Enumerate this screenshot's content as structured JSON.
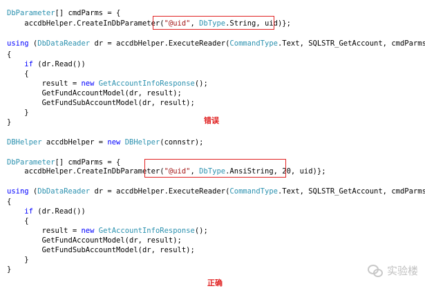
{
  "block1": {
    "lines": [
      [
        {
          "t": "DbParameter",
          "c": "ty"
        },
        {
          "t": "[] cmdParms = {"
        }
      ],
      [
        {
          "t": "    accdbHelper.CreateInDbParameter("
        },
        {
          "t": "\"@uid\"",
          "c": "str"
        },
        {
          "t": ", "
        },
        {
          "t": "DbType",
          "c": "ty"
        },
        {
          "t": ".String, uid)"
        },
        {
          "t": "};"
        }
      ],
      [
        {
          "t": ""
        }
      ],
      [
        {
          "t": "using",
          "c": "kw"
        },
        {
          "t": " ("
        },
        {
          "t": "DbDataReader",
          "c": "ty"
        },
        {
          "t": " dr = accdbHelper.ExecuteReader("
        },
        {
          "t": "CommandType",
          "c": "ty"
        },
        {
          "t": ".Text, SQLSTR_GetAccount, cmdParms))"
        }
      ],
      [
        {
          "t": "{"
        }
      ],
      [
        {
          "t": "    "
        },
        {
          "t": "if",
          "c": "kw"
        },
        {
          "t": " (dr.Read())"
        }
      ],
      [
        {
          "t": "    {"
        }
      ],
      [
        {
          "t": "        result = "
        },
        {
          "t": "new",
          "c": "kw"
        },
        {
          "t": " "
        },
        {
          "t": "GetAccountInfoResponse",
          "c": "ty"
        },
        {
          "t": "();"
        }
      ],
      [
        {
          "t": "        GetFundAccountModel(dr, result);"
        }
      ],
      [
        {
          "t": "        GetFundSubAccountModel(dr, result);"
        }
      ],
      [
        {
          "t": "    }"
        }
      ],
      [
        {
          "t": "}"
        }
      ]
    ]
  },
  "label_wrong": "错误",
  "block2": {
    "lines": [
      [
        {
          "t": "DBHelper",
          "c": "ty"
        },
        {
          "t": " accdbHelper = "
        },
        {
          "t": "new",
          "c": "kw"
        },
        {
          "t": " "
        },
        {
          "t": "DBHelper",
          "c": "ty"
        },
        {
          "t": "(connstr);"
        }
      ],
      [
        {
          "t": ""
        }
      ],
      [
        {
          "t": "DbParameter",
          "c": "ty"
        },
        {
          "t": "[] cmdParms = {"
        }
      ],
      [
        {
          "t": "    accdbHelper.CreateInDbParameter("
        },
        {
          "t": "\"@uid\"",
          "c": "str"
        },
        {
          "t": ", "
        },
        {
          "t": "DbType",
          "c": "ty"
        },
        {
          "t": ".AnsiString, 20, uid)"
        },
        {
          "t": "};"
        }
      ],
      [
        {
          "t": ""
        }
      ],
      [
        {
          "t": "using",
          "c": "kw"
        },
        {
          "t": " ("
        },
        {
          "t": "DbDataReader",
          "c": "ty"
        },
        {
          "t": " dr = accdbHelper.ExecuteReader("
        },
        {
          "t": "CommandType",
          "c": "ty"
        },
        {
          "t": ".Text, SQLSTR_GetAccount, cmdParms))"
        }
      ],
      [
        {
          "t": "{"
        }
      ],
      [
        {
          "t": "    "
        },
        {
          "t": "if",
          "c": "kw"
        },
        {
          "t": " (dr.Read())"
        }
      ],
      [
        {
          "t": "    {"
        }
      ],
      [
        {
          "t": "        result = "
        },
        {
          "t": "new",
          "c": "kw"
        },
        {
          "t": " "
        },
        {
          "t": "GetAccountInfoResponse",
          "c": "ty"
        },
        {
          "t": "();"
        }
      ],
      [
        {
          "t": "        GetFundAccountModel(dr, result);"
        }
      ],
      [
        {
          "t": "        GetFundSubAccountModel(dr, result);"
        }
      ],
      [
        {
          "t": "    }"
        }
      ],
      [
        {
          "t": "}"
        }
      ]
    ]
  },
  "label_right": "正确",
  "watermark": {
    "text": "实验楼",
    "icon": "wechat-icon"
  },
  "colors": {
    "keyword": "#0000ff",
    "type": "#2b91af",
    "string": "#a31515",
    "highlight": "#e02020"
  }
}
